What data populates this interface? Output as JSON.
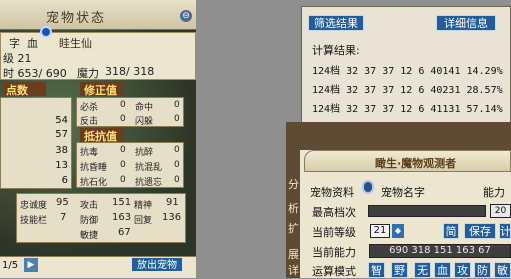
{
  "pet_window": {
    "title": "宠物状态",
    "close_icon": "close-icon",
    "info": {
      "name_label": "字",
      "name_extra": "血",
      "line2": "级    21",
      "hp_line": "时  653/ 690",
      "mp_label": "魔力",
      "mp_value": "318/ 318",
      "overlay_name": "眭生仙"
    },
    "ribbons": {
      "a": "点数",
      "b": "修正值",
      "c": "抵抗值"
    },
    "left_stats": [
      "54",
      "57",
      "38",
      "13",
      "6"
    ],
    "correction": {
      "rows": [
        {
          "label": "必杀",
          "value": "0",
          "label2": "命中",
          "value2": "0"
        },
        {
          "label": "反击",
          "value": "0",
          "label2": "闪躲",
          "value2": "0"
        }
      ]
    },
    "resistance": {
      "rows": [
        {
          "label": "抗毒",
          "value": "0",
          "label2": "抗醉",
          "value2": "0"
        },
        {
          "label": "抗昏睡",
          "value": "0",
          "label2": "抗混乱",
          "value2": "0"
        },
        {
          "label": "抗石化",
          "value": "0",
          "label2": "抗遗忘",
          "value2": "0"
        }
      ]
    },
    "bottom_stats": {
      "rows": [
        {
          "label": "忠诚度",
          "value": "95",
          "label2": "攻击",
          "value2": "151",
          "label3": "精神",
          "value3": "91"
        },
        {
          "label": "技能栏",
          "value": "7",
          "label2": "防御",
          "value2": "163",
          "label3": "回复",
          "value3": "136"
        },
        {
          "label": "",
          "value": "",
          "label2": "敏捷",
          "value2": "67",
          "label3": "",
          "value3": ""
        }
      ]
    },
    "page": "1/5",
    "release_button": "放出宠物"
  },
  "results_window": {
    "filter_button": "筛选结果",
    "detail_button": "详细信息",
    "header": "计算结果:",
    "lines": [
      "124档 32 37 37 12 6 40141 14.29%",
      "124档 32 37 37 12 6 40231 28.57%",
      "124档 32 37 37 12 6 41131 57.14%"
    ]
  },
  "observer_window": {
    "title": "瞰生·魔物观测者",
    "side_tabs": [
      "分",
      "析",
      "扩",
      "展",
      "详"
    ],
    "pet_data_label": "宠物资料",
    "pet_name_label": "宠物名字",
    "ability_label": "能力",
    "max_grade_label": "最高档次",
    "max_grade_right": "20",
    "current_level_label": "当前等级",
    "current_level_value": "21",
    "simple_button": "简",
    "save_button": "保存",
    "calc_button": "计",
    "current_ability_label": "当前能力",
    "current_ability_value": "690 318 151 163 67",
    "mode_label": "运算模式",
    "modes": [
      "智",
      "野",
      "无",
      "血",
      "攻",
      "防",
      "敏"
    ]
  }
}
